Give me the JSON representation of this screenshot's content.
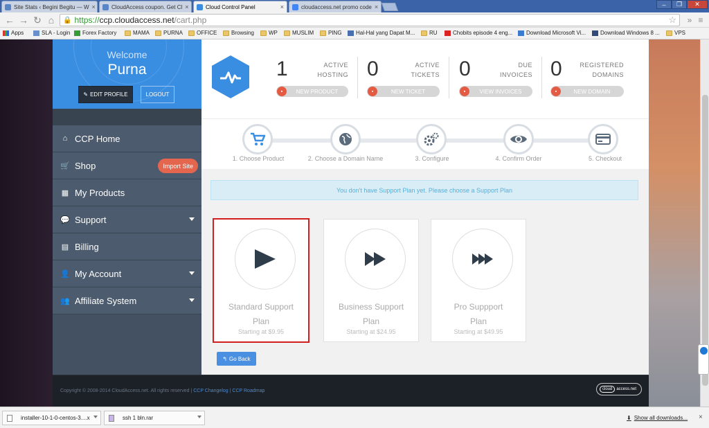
{
  "browser": {
    "tabs": [
      {
        "title": "Site Stats ‹ Begini Begitu — W",
        "color": "#5b86c5"
      },
      {
        "title": "CloudAccess coupon. Get Cl",
        "color": "#5b86c5"
      },
      {
        "title": "Cloud Control Panel",
        "color": "#3a8ee2"
      },
      {
        "title": "cloudaccess.net promo code",
        "color": "#4285f4"
      }
    ],
    "close_glyph": "×",
    "url_https": "https://",
    "url_domain": "ccp.cloudaccess.net",
    "url_path": "/cart.php",
    "bookmarks": [
      "Apps",
      "SLA - Login",
      "Forex Factory",
      "MAMA",
      "PURNA",
      "OFFICE",
      "Browsing",
      "WP",
      "MUSLIM",
      "PING",
      "Hal-Hal yang Dapat M...",
      "RU",
      "Chobits episode 4 eng...",
      "Download Microsoft Vi...",
      "Download Windows 8 ...",
      "VPS"
    ],
    "bookmarks_more": "»"
  },
  "sidebar": {
    "welcome": "Welcome",
    "username": "Purna",
    "edit_profile": "EDIT PROFILE",
    "logout": "LOGOUT",
    "menu": [
      {
        "label": "CCP Home",
        "icon": "home-icon"
      },
      {
        "label": "Shop",
        "icon": "cart-icon",
        "badge": "Import Site"
      },
      {
        "label": "My Products",
        "icon": "grid-icon"
      },
      {
        "label": "Support",
        "icon": "chat-icon",
        "dropdown": true
      },
      {
        "label": "Billing",
        "icon": "billing-icon"
      },
      {
        "label": "My Account",
        "icon": "user-icon",
        "dropdown": true
      },
      {
        "label": "Affiliate System",
        "icon": "group-icon",
        "dropdown": true
      }
    ]
  },
  "stats": [
    {
      "num": "1",
      "line1": "ACTIVE",
      "line2": "HOSTING",
      "button": "NEW PRODUCT"
    },
    {
      "num": "0",
      "line1": "ACTIVE",
      "line2": "TICKETS",
      "button": "NEW TICKET"
    },
    {
      "num": "0",
      "line1": "DUE",
      "line2": "INVOICES",
      "button": "VIEW INVOICES"
    },
    {
      "num": "0",
      "line1": "REGISTERED",
      "line2": "DOMAINS",
      "button": "NEW DOMAIN"
    }
  ],
  "steps": [
    {
      "label": "1. Choose Product",
      "icon": "cart-icon"
    },
    {
      "label": "2. Choose a Domain Name",
      "icon": "globe-icon"
    },
    {
      "label": "3. Configure",
      "icon": "gears-icon"
    },
    {
      "label": "4. Confirm Order",
      "icon": "eye-icon"
    },
    {
      "label": "5. Checkout",
      "icon": "card-icon"
    }
  ],
  "alert": "You don't have Support Plan yet. Please choose a Support Plan",
  "plans": [
    {
      "line1": "Standard Support",
      "line2": "Plan",
      "price": "Starting at $9.95",
      "selected": true
    },
    {
      "line1": "Business Support",
      "line2": "Plan",
      "price": "Starting at $24.95"
    },
    {
      "line1": "Pro Suppport",
      "line2": "Plan",
      "price": "Starting at $49.95"
    }
  ],
  "go_back": "Go Back",
  "footer": {
    "copyright": "Copyright © 2008-2014 CloudAccess.net. All rights reserved |",
    "changelog": "CCP Changelog",
    "sep": "|",
    "roadmap": "CCP Roadmap",
    "logo_cloud": "cloud",
    "logo_rest": "access.net"
  },
  "downloads": {
    "items": [
      "installer-10-1-0-centos-3....x",
      "ssh 1 bln.rar"
    ],
    "show_all": "Show all downloads...",
    "close": "×"
  },
  "colors": {
    "accent": "#3a8ee2",
    "sidebar": "#435163",
    "badge": "#e5664e",
    "selected_outline": "#d11f1f"
  }
}
